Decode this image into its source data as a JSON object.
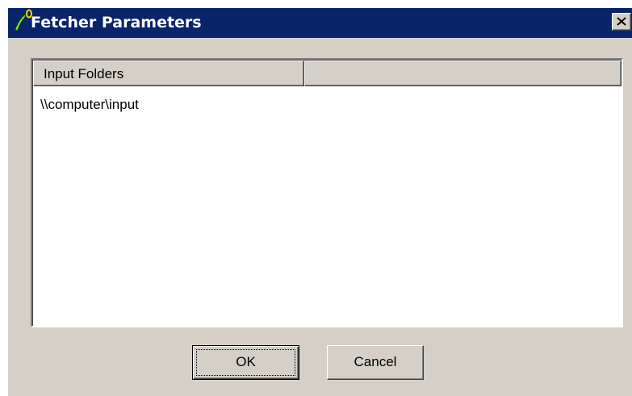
{
  "window": {
    "title": "Fetcher Parameters",
    "icons": {
      "app": "app-icon",
      "close": "close-icon"
    },
    "colors": {
      "titlebar": "#0a246a",
      "face": "#d4d0c8",
      "list_bg": "#ffffff"
    }
  },
  "listview": {
    "columns": [
      "Input Folders",
      ""
    ],
    "rows": [
      "\\\\computer\\input"
    ]
  },
  "buttons": {
    "ok_label": "OK",
    "cancel_label": "Cancel"
  }
}
